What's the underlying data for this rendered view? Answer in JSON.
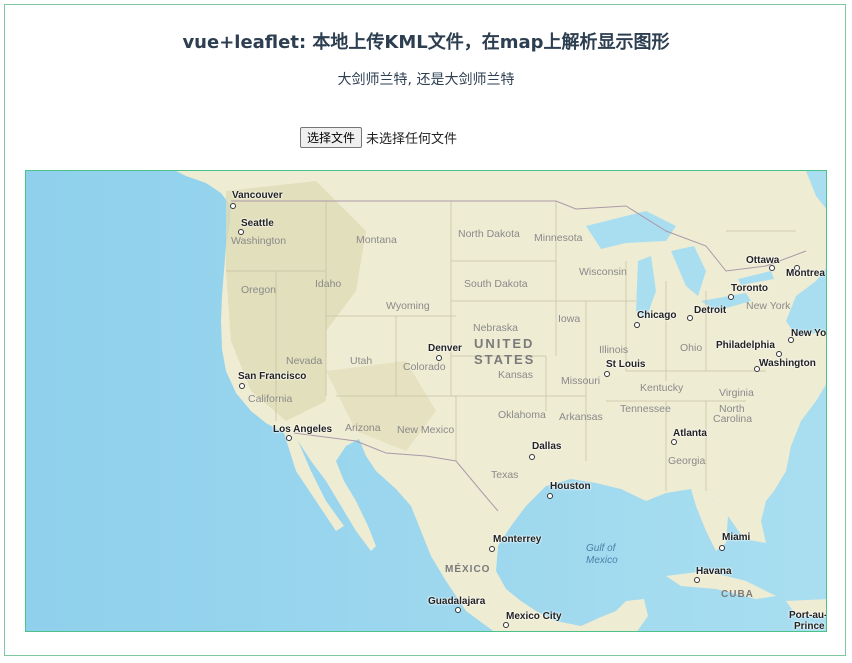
{
  "page": {
    "title": "vue+leaflet: 本地上传KML文件，在map上解析显示图形",
    "subtitle": "大剑师兰特, 还是大剑师兰特"
  },
  "file_input": {
    "button_label": "选择文件",
    "status": "未选择任何文件"
  },
  "map": {
    "cities": [
      "Vancouver",
      "Seattle",
      "Ottawa",
      "Montreal",
      "Toronto",
      "Chicago",
      "Detroit",
      "New York",
      "Philadelphia",
      "New York",
      "Washington",
      "Denver",
      "San Francisco",
      "St Louis",
      "Los Angeles",
      "Atlanta",
      "Dallas",
      "Houston",
      "Monterrey",
      "Miami",
      "Havana",
      "Guadalajara",
      "Mexico City",
      "Port-au-Prince"
    ],
    "cities_display": [
      "Vancouver",
      "Seattle",
      "Ottawa",
      "Montrea",
      "Toronto",
      "Chicago",
      "Detroit",
      "New York",
      "Philadelphia",
      "New Yo",
      "Washington",
      "Denver",
      "San Francisco",
      "St Louis",
      "Los Angeles",
      "Atlanta",
      "Dallas",
      "Houston",
      "Monterrey",
      "Miami",
      "Havana",
      "Guadalajara",
      "Mexico City",
      "Port-au-",
      "Prince"
    ],
    "states": [
      "Washington",
      "Montana",
      "North Dakota",
      "Minnesota",
      "Wisconsin",
      "Oregon",
      "Idaho",
      "South Dakota",
      "Wyoming",
      "Iowa",
      "Nebraska",
      "Illinois",
      "Ohio",
      "Nevada",
      "Utah",
      "Colorado",
      "Kansas",
      "Missouri",
      "Kentucky",
      "Virginia",
      "California",
      "Oklahoma",
      "Arkansas",
      "Tennessee",
      "North",
      "Carolina",
      "Arizona",
      "New Mexico",
      "Georgia",
      "Texas"
    ],
    "countries": {
      "usa_line1": "UNITED",
      "usa_line2": "STATES",
      "mexico": "MÉXICO",
      "cuba": "CUBA"
    },
    "water": {
      "gulf_line1": "Gulf of",
      "gulf_line2": "Mexico"
    },
    "colors": {
      "ocean": "#a6dcef",
      "land": "#efecd4",
      "mountain": "#dcdcb0",
      "border": "#4cc28a"
    }
  }
}
